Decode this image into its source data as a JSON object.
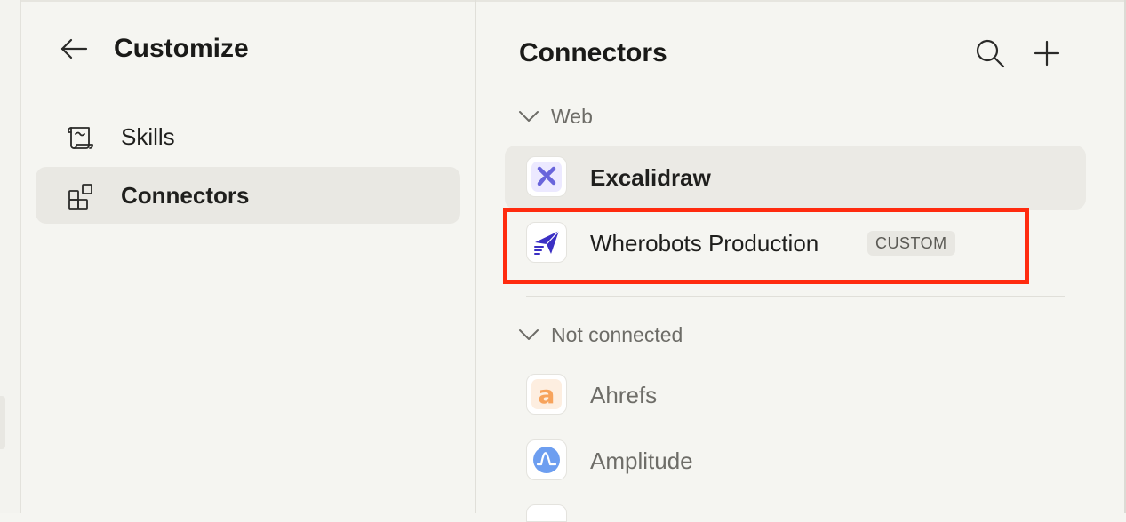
{
  "sidebar": {
    "title": "Customize",
    "items": [
      {
        "label": "Skills",
        "icon": "scroll-icon",
        "active": false
      },
      {
        "label": "Connectors",
        "icon": "grid-plus-icon",
        "active": true
      }
    ]
  },
  "main": {
    "title": "Connectors",
    "sections": [
      {
        "label": "Web",
        "connectors": [
          {
            "name": "Excalidraw",
            "icon": "excalidraw-icon"
          },
          {
            "name": "Wherobots Production",
            "icon": "wherobots-icon",
            "badge": "CUSTOM"
          }
        ]
      },
      {
        "label": "Not connected",
        "connectors": [
          {
            "name": "Ahrefs",
            "icon": "ahrefs-icon"
          },
          {
            "name": "Amplitude",
            "icon": "amplitude-icon"
          }
        ]
      }
    ]
  },
  "colors": {
    "background": "#f5f5f1",
    "active_item": "#e9e8e3",
    "highlight": "#ff2b0f",
    "excalidraw": "#6965db",
    "wherobots": "#3b30c4",
    "ahrefs": "#f7a35c",
    "amplitude": "#6d9ef0"
  }
}
